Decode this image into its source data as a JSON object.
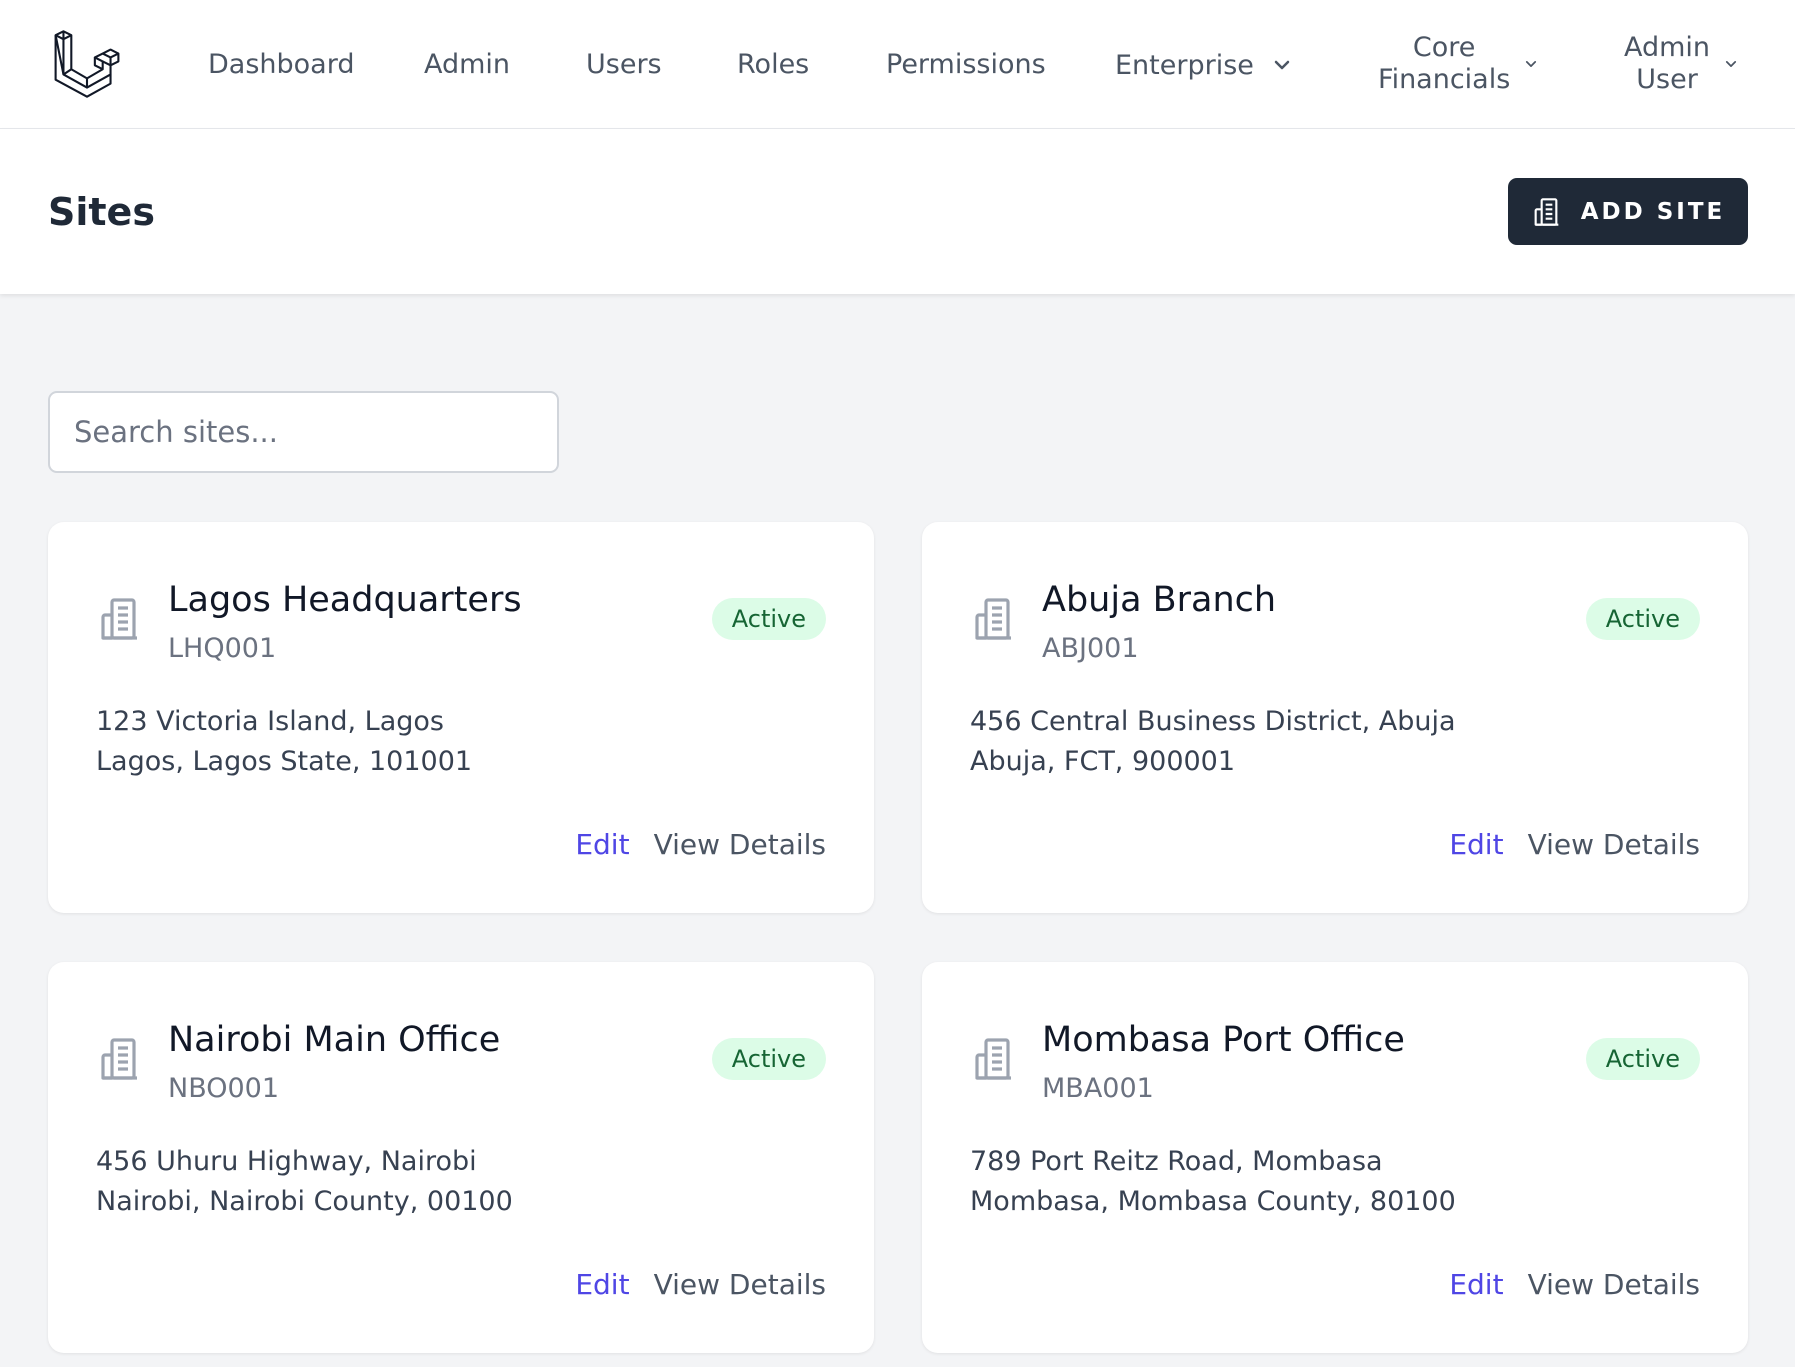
{
  "nav": {
    "links": [
      "Dashboard",
      "Admin",
      "Users",
      "Roles",
      "Permissions"
    ],
    "enterprise_label": "Enterprise",
    "core_line1": "Core",
    "core_line2": "Financials",
    "user_line1": "Admin",
    "user_line2": "User"
  },
  "header": {
    "title": "Sites",
    "add_label": "ADD SITE"
  },
  "search": {
    "placeholder": "Search sites..."
  },
  "sites": [
    {
      "name": "Lagos Headquarters",
      "code": "LHQ001",
      "status": "Active",
      "address_line1": "123 Victoria Island, Lagos",
      "address_line2": "Lagos, Lagos State, 101001",
      "edit_label": "Edit",
      "view_label": "View Details"
    },
    {
      "name": "Abuja Branch",
      "code": "ABJ001",
      "status": "Active",
      "address_line1": "456 Central Business District, Abuja",
      "address_line2": "Abuja, FCT, 900001",
      "edit_label": "Edit",
      "view_label": "View Details"
    },
    {
      "name": "Nairobi Main Office",
      "code": "NBO001",
      "status": "Active",
      "address_line1": "456 Uhuru Highway, Nairobi",
      "address_line2": "Nairobi, Nairobi County, 00100",
      "edit_label": "Edit",
      "view_label": "View Details"
    },
    {
      "name": "Mombasa Port Office",
      "code": "MBA001",
      "status": "Active",
      "address_line1": "789 Port Reitz Road, Mombasa",
      "address_line2": "Mombasa, Mombasa County, 80100",
      "edit_label": "Edit",
      "view_label": "View Details"
    }
  ],
  "colors": {
    "accent": "#4f46e5",
    "button_dark": "#1f2937",
    "badge_bg": "#dcfce7",
    "badge_text": "#166534",
    "page_bg": "#f3f4f6"
  },
  "icons": {
    "logo": "laravel-logo",
    "add_button": "building-icon",
    "site": "building-icon",
    "dropdown": "chevron-down-icon"
  }
}
